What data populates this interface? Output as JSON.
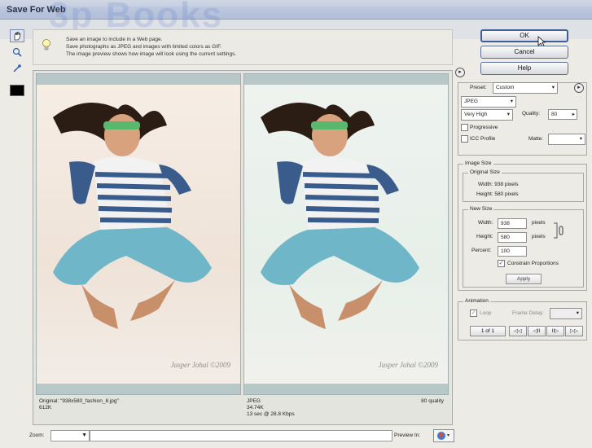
{
  "window": {
    "title": "Save For Web",
    "watermark": "3p Books"
  },
  "tools": [
    "hand-icon",
    "zoom-icon",
    "eyedropper-icon"
  ],
  "info": {
    "line1": "Save an image to include in a Web page.",
    "line2": "Save photographs as JPEG and images with limited colors as GIF.",
    "line3": "The image preview shows how image will look using the current settings."
  },
  "preview": {
    "credit": "Jasper Johal ©2009",
    "original": {
      "line1": "Original: \"938x580_fashion_8.jpg\"",
      "line2": "612K"
    },
    "optimized": {
      "line1": "JPEG",
      "line2": "34.74K",
      "line3": "13 sec @ 28.8 Kbps",
      "quality": "80 quality"
    }
  },
  "bottom": {
    "zoom_label": "Zoom:",
    "zoom_value": "",
    "preview_in_label": "Preview In:"
  },
  "buttons": {
    "ok": "OK",
    "cancel": "Cancel",
    "help": "Help"
  },
  "settings": {
    "preset_label": "Preset:",
    "preset_value": "Custom",
    "format": "JPEG",
    "quality_preset": "Very High",
    "quality_label": "Quality:",
    "quality_value": "80",
    "progressive_label": "Progressive",
    "progressive_checked": false,
    "icc_label": "ICC Profile",
    "icc_checked": false,
    "matte_label": "Matte:",
    "matte_value": ""
  },
  "image_size": {
    "title": "Image Size",
    "original_size_title": "Original Size",
    "orig_width": "Width: 938 pixels",
    "orig_height": "Height: 580 pixels",
    "new_size_title": "New Size",
    "width_label": "Width:",
    "width_value": "938",
    "height_label": "Height:",
    "height_value": "580",
    "percent_label": "Percent:",
    "percent_value": "100",
    "pixels_label": "pixels",
    "constrain_label": "Constrain Proportions",
    "constrain_checked": true,
    "apply_label": "Apply"
  },
  "animation": {
    "title": "Animation",
    "loop_label": "Loop",
    "frame_delay_label": "Frame Delay:",
    "frame_counter": "1 of 1",
    "nav": [
      "◁◁",
      "◁II",
      "II▷",
      "▷▷"
    ]
  },
  "colors": {
    "accent": "#3e5f99",
    "titlebar": "#c3cbdb",
    "pane_bar": "#b8c8c8"
  }
}
